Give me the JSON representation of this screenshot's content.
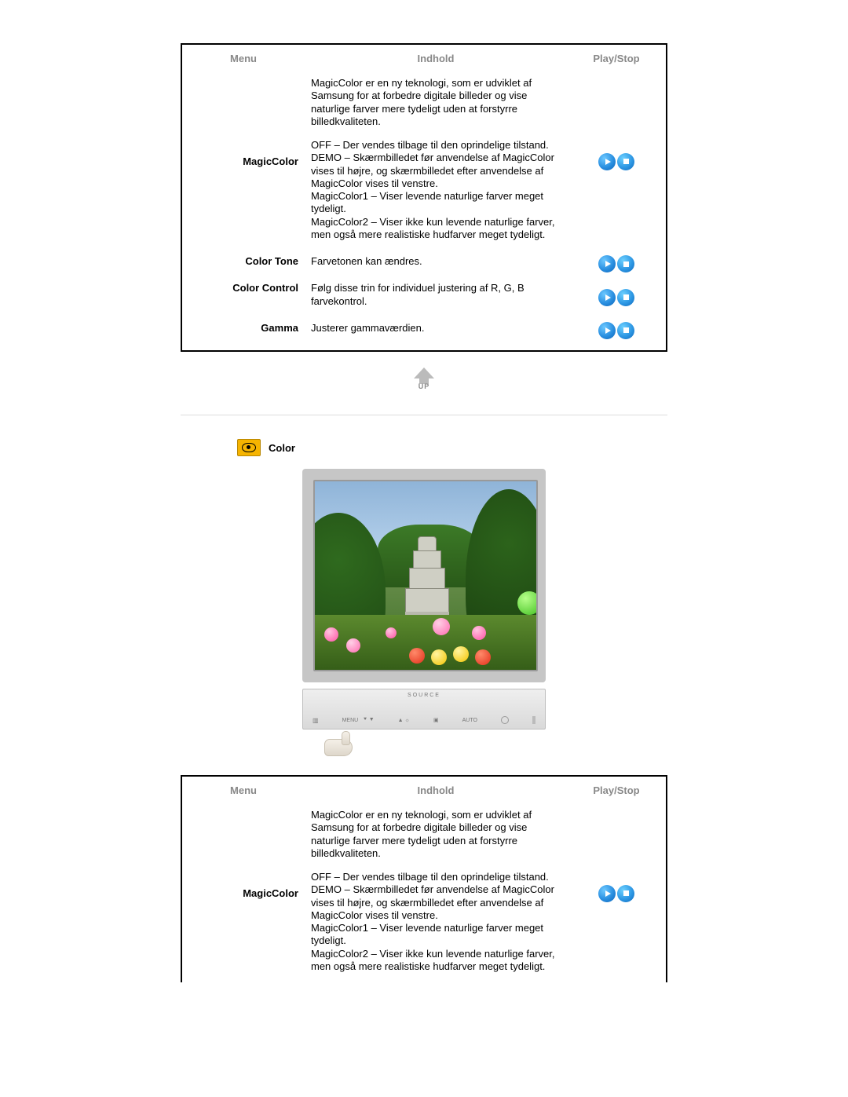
{
  "tables": {
    "headers": {
      "menu": "Menu",
      "indhold": "Indhold",
      "playstop": "Play/Stop"
    }
  },
  "table1": {
    "rows": [
      {
        "label": "MagicColor",
        "desc": [
          "MagicColor er en ny teknologi, som er udviklet af Samsung for at forbedre digitale billeder og vise naturlige farver mere tydeligt uden at forstyrre billedkvaliteten.",
          "OFF – Der vendes tilbage til den oprindelige tilstand.\nDEMO – Skærmbilledet før anvendelse af MagicColor vises til højre, og skærmbilledet efter anvendelse af MagicColor vises til venstre.\nMagicColor1 – Viser levende naturlige farver meget tydeligt.\nMagicColor2 – Viser ikke kun levende naturlige farver, men også mere realistiske hudfarver meget tydeligt."
        ]
      },
      {
        "label": "Color Tone",
        "desc": [
          "Farvetonen kan ændres."
        ]
      },
      {
        "label": "Color Control",
        "desc": [
          "Følg disse trin for individuel justering af R, G, B farvekontrol."
        ]
      },
      {
        "label": "Gamma",
        "desc": [
          "Justerer gammaværdien."
        ]
      }
    ]
  },
  "up_label": "UP",
  "section2": {
    "title": "Color"
  },
  "monitor_controls": {
    "source": "SOURCE",
    "menu": "MENU",
    "auto": "AUTO"
  },
  "table2": {
    "rows": [
      {
        "label": "MagicColor",
        "desc": [
          "MagicColor er en ny teknologi, som er udviklet af Samsung for at forbedre digitale billeder og vise naturlige farver mere tydeligt uden at forstyrre billedkvaliteten.",
          "OFF – Der vendes tilbage til den oprindelige tilstand.\nDEMO – Skærmbilledet før anvendelse af MagicColor vises til højre, og skærmbilledet efter anvendelse af MagicColor vises til venstre.\nMagicColor1 – Viser levende naturlige farver meget tydeligt.\nMagicColor2 – Viser ikke kun levende naturlige farver, men også mere realistiske hudfarver meget tydeligt."
        ]
      }
    ]
  }
}
